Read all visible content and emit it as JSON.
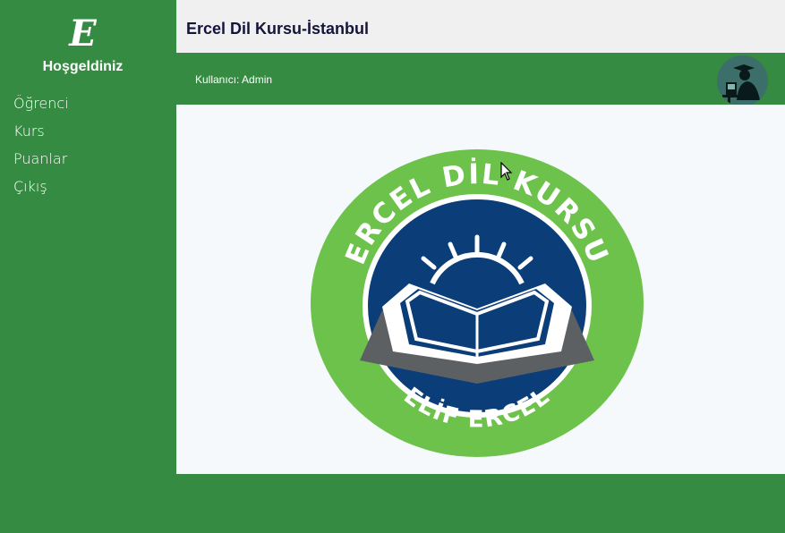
{
  "sidebar": {
    "logo_letter": "E",
    "welcome": "Hoşgeldiniz",
    "items": [
      {
        "label": "Öğrenci"
      },
      {
        "label": "Kurs"
      },
      {
        "label": "Puanlar"
      },
      {
        "label": "Çıkış"
      }
    ]
  },
  "header": {
    "title": "Ercel Dil Kursu-İstanbul"
  },
  "userbar": {
    "user_label": "Kullanıcı: Admin"
  },
  "emblem": {
    "top_text": "ERCEL DİL KURSU",
    "bottom_text": "ELİF ERCEL"
  },
  "colors": {
    "primary_green": "#368b43",
    "emblem_green": "#6cc24a",
    "emblem_blue": "#0b3d78",
    "title_text": "#14143c"
  },
  "icons": [
    "avatar-graduate-icon",
    "cursor-arrow-icon",
    "open-book-icon"
  ]
}
